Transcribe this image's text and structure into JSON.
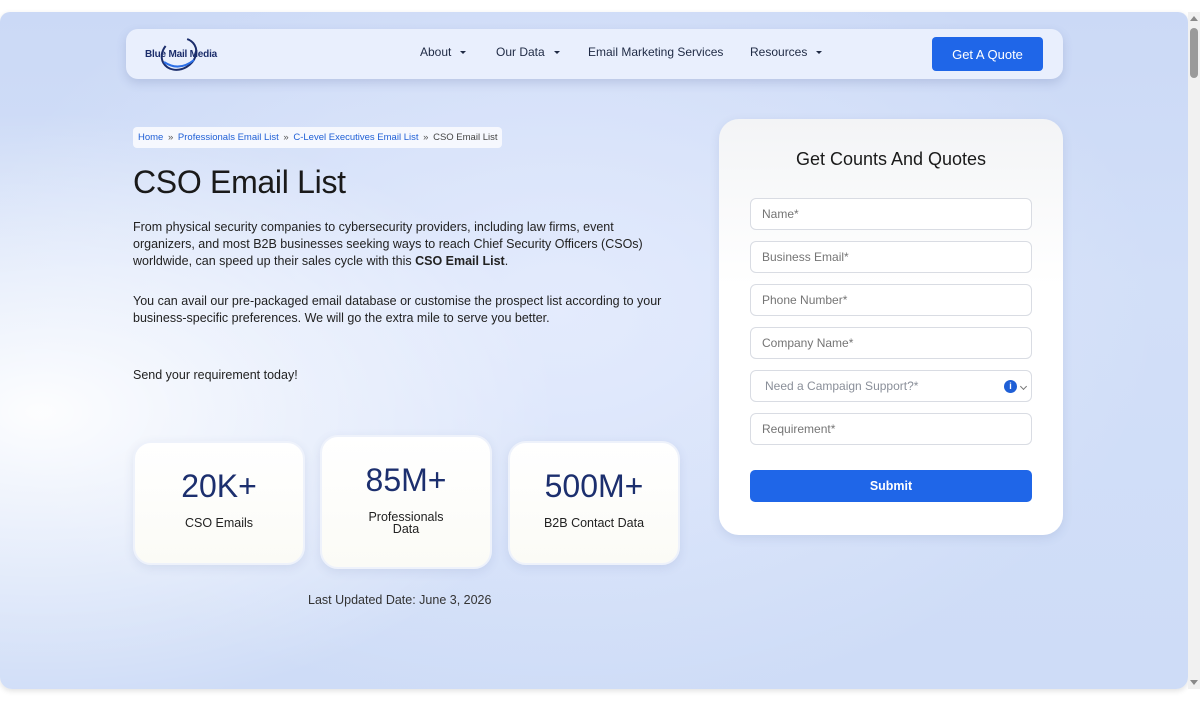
{
  "nav": {
    "logo_text": "Blue Mail Media",
    "items": [
      {
        "label": "About"
      },
      {
        "label": "Our Data"
      },
      {
        "label": "Email Marketing Services"
      },
      {
        "label": "Resources"
      }
    ],
    "quote_label": "Get A Quote"
  },
  "breadcrumb": {
    "items": [
      {
        "label": "Home"
      },
      {
        "label": "Professionals Email List"
      },
      {
        "label": "C-Level Executives Email List"
      },
      {
        "label": "CSO Email List"
      }
    ],
    "separator": "»"
  },
  "hero": {
    "title": "CSO Email List",
    "para1_text": "From physical security companies to cybersecurity providers, including law firms, event organizers, and most B2B businesses seeking ways to reach Chief Security Officers (CSOs) worldwide, can speed up their sales cycle with this ",
    "para1_bold": "CSO Email List",
    "para1_end": ".",
    "para2": "You can avail our pre-packaged email database or customise the prospect list according to your business-specific preferences. We will go the extra mile to serve you better.",
    "para3": "Send your requirement today!"
  },
  "stats": [
    {
      "value": "20K+",
      "label": "CSO Emails"
    },
    {
      "value": "85M+",
      "label_line1": "Professionals",
      "label_line2": "Data"
    },
    {
      "value": "500M+",
      "label": "B2B Contact Data"
    }
  ],
  "updated_text": "Last Updated Date: June 3, 2026",
  "form": {
    "title": "Get Counts And Quotes",
    "name_placeholder": "Name*",
    "email_placeholder": "Business Email*",
    "phone_placeholder": "Phone Number*",
    "company_placeholder": "Company Name*",
    "campaign_placeholder": "Need a Campaign Support?*",
    "info_glyph": "i",
    "requirement_placeholder": "Requirement*",
    "submit_label": "Submit"
  },
  "colors": {
    "accent": "#1f66e8",
    "brand_dark": "#1c2f6e",
    "link": "#1f5fd6"
  }
}
